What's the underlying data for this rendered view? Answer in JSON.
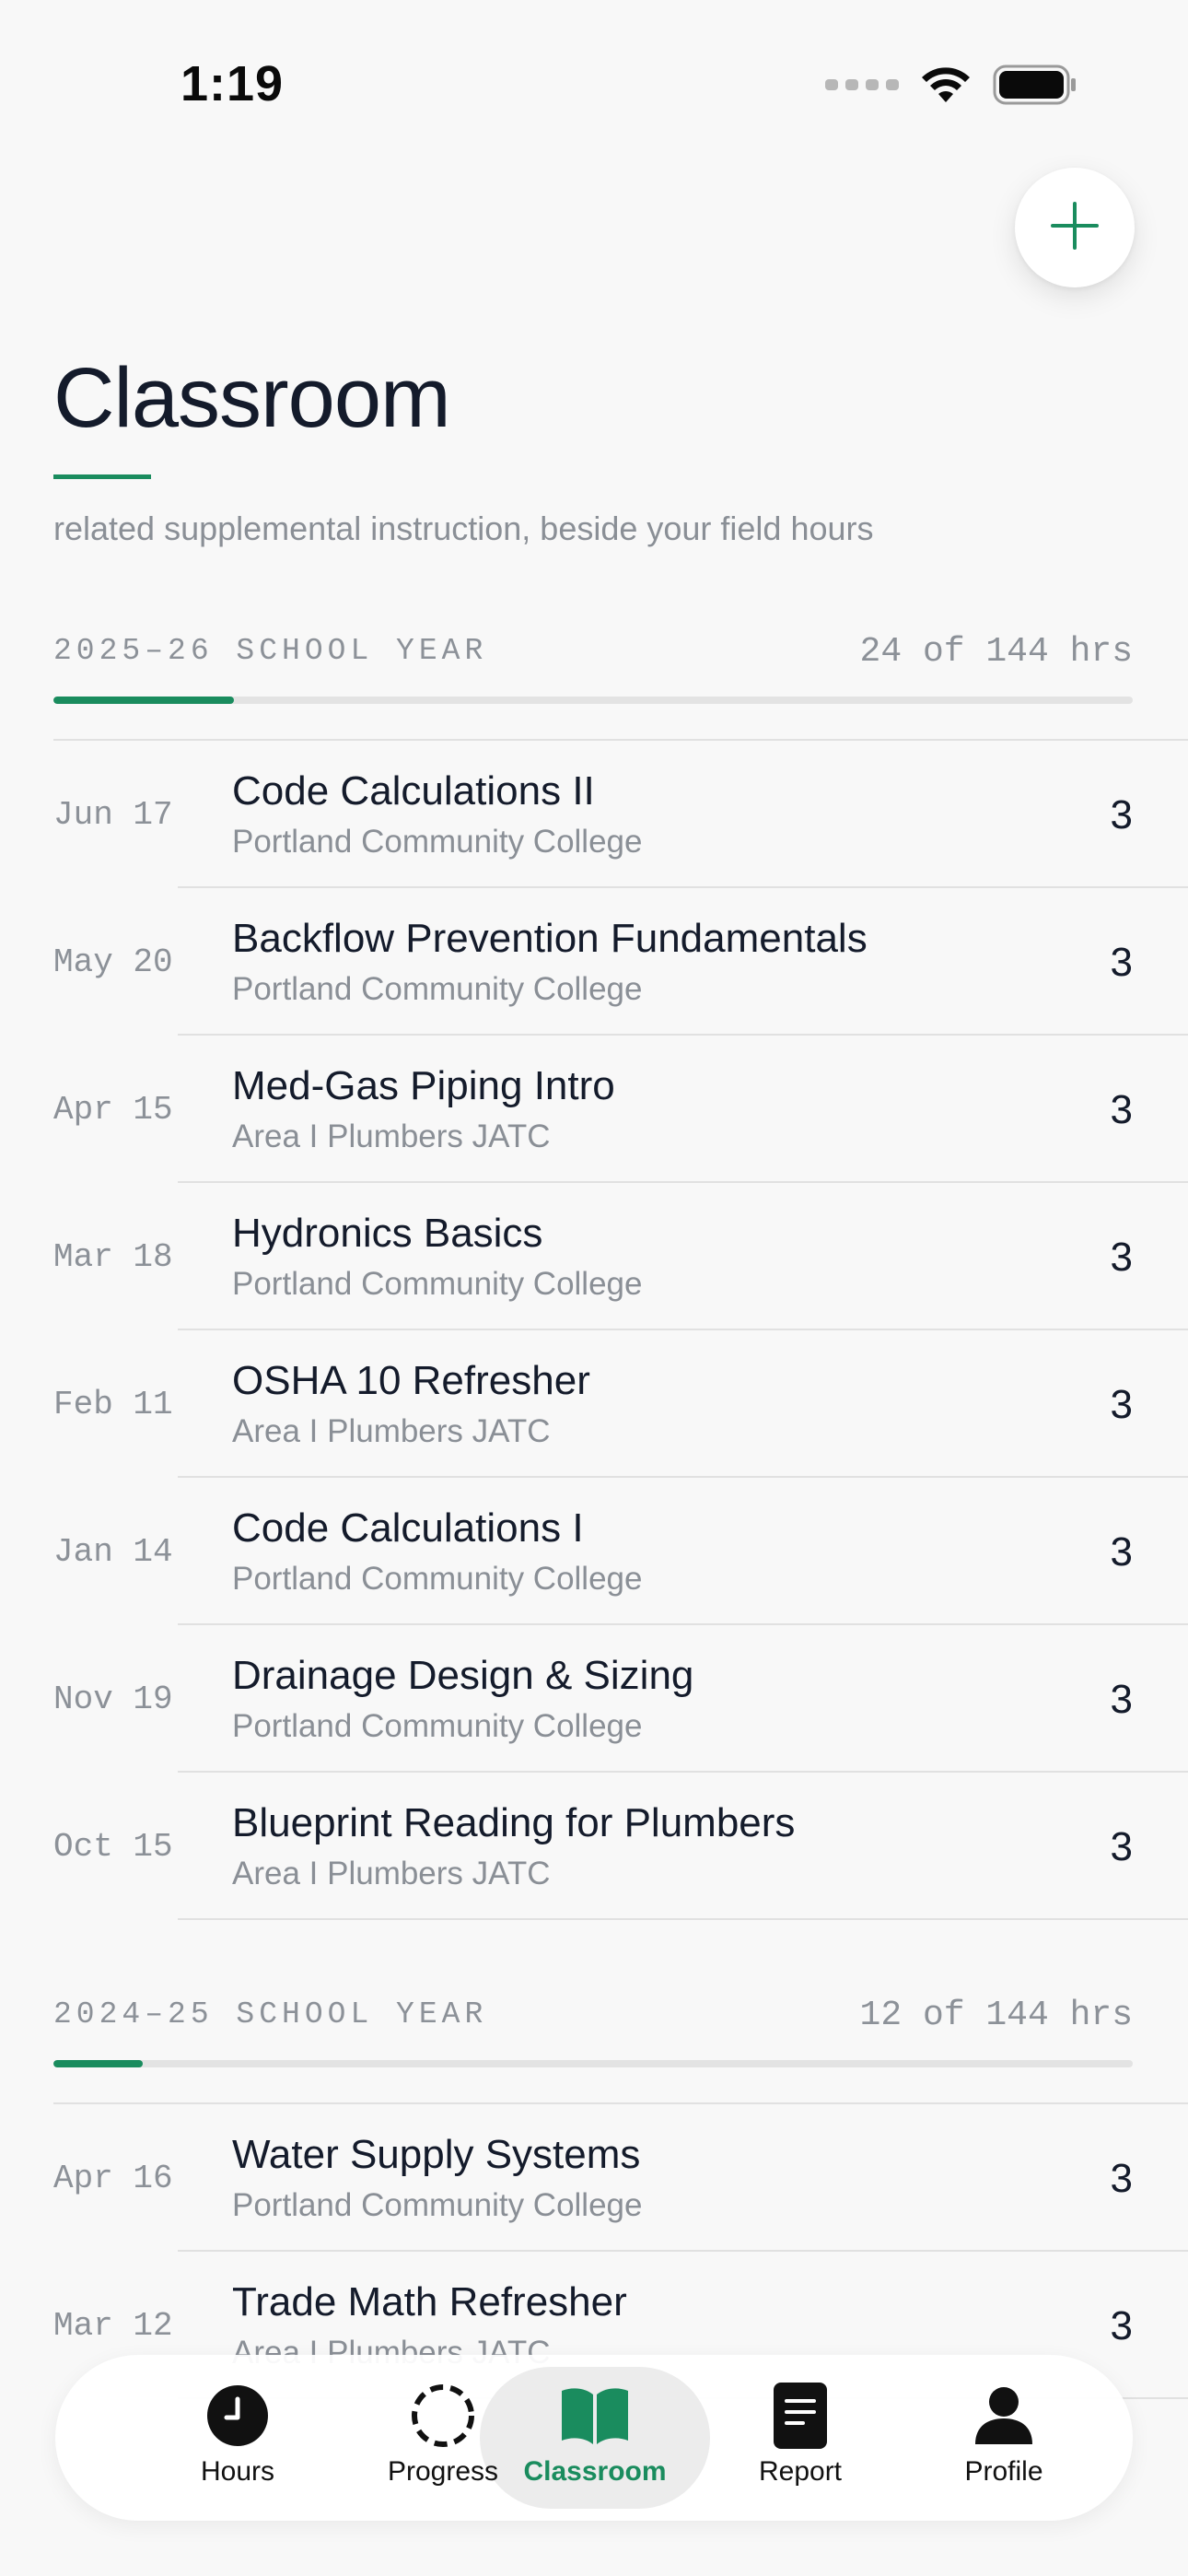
{
  "status_bar": {
    "time": "1:19"
  },
  "fab": {
    "icon": "plus-icon"
  },
  "header": {
    "title": "Classroom",
    "subtitle": "related supplemental instruction, beside your field hours"
  },
  "sections": [
    {
      "label": "2025–26 SCHOOL YEAR",
      "total": "24 of 144 hrs",
      "progress": 0.167,
      "rows": [
        {
          "date": "Jun 17",
          "title": "Code Calculations II",
          "school": "Portland Community College",
          "hours": "3"
        },
        {
          "date": "May 20",
          "title": "Backflow Prevention Fundamentals",
          "school": "Portland Community College",
          "hours": "3"
        },
        {
          "date": "Apr 15",
          "title": "Med-Gas Piping Intro",
          "school": "Area I Plumbers JATC",
          "hours": "3"
        },
        {
          "date": "Mar 18",
          "title": "Hydronics Basics",
          "school": "Portland Community College",
          "hours": "3"
        },
        {
          "date": "Feb 11",
          "title": "OSHA 10 Refresher",
          "school": "Area I Plumbers JATC",
          "hours": "3"
        },
        {
          "date": "Jan 14",
          "title": "Code Calculations I",
          "school": "Portland Community College",
          "hours": "3"
        },
        {
          "date": "Nov 19",
          "title": "Drainage Design & Sizing",
          "school": "Portland Community College",
          "hours": "3"
        },
        {
          "date": "Oct 15",
          "title": "Blueprint Reading for Plumbers",
          "school": "Area I Plumbers JATC",
          "hours": "3"
        }
      ]
    },
    {
      "label": "2024–25 SCHOOL YEAR",
      "total": "12 of 144 hrs",
      "progress": 0.083,
      "rows": [
        {
          "date": "Apr 16",
          "title": "Water Supply Systems",
          "school": "Portland Community College",
          "hours": "3"
        },
        {
          "date": "Mar 12",
          "title": "Trade Math Refresher",
          "school": "Area I Plumbers JATC",
          "hours": "3"
        }
      ]
    }
  ],
  "tabs": [
    {
      "label": "Hours",
      "icon": "clock-icon",
      "active": false
    },
    {
      "label": "Progress",
      "icon": "progress-ring-icon",
      "active": false
    },
    {
      "label": "Classroom",
      "icon": "book-icon",
      "active": true
    },
    {
      "label": "Report",
      "icon": "document-icon",
      "active": false
    },
    {
      "label": "Profile",
      "icon": "person-icon",
      "active": false
    }
  ],
  "colors": {
    "accent": "#1a8c5e",
    "background": "#f8f8f8",
    "text_primary": "#141b2b",
    "text_secondary": "#8a8f96"
  }
}
